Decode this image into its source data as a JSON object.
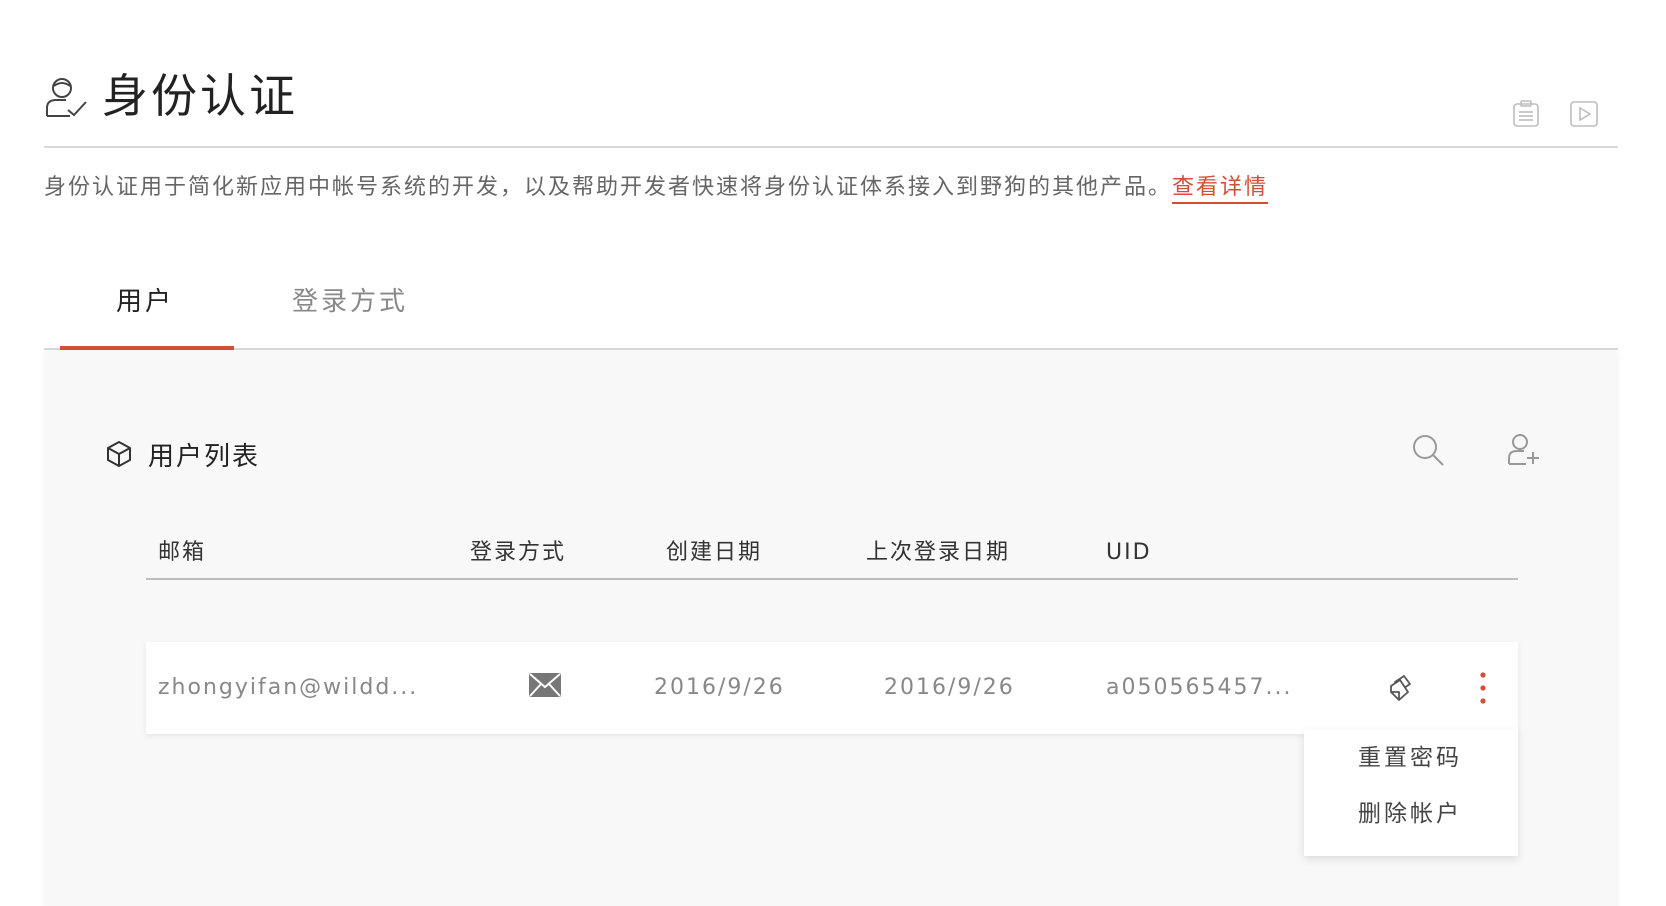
{
  "header": {
    "title": "身份认证",
    "icon": "user-check-icon",
    "tools": [
      "document-icon",
      "play-video-icon"
    ]
  },
  "description": {
    "text": "身份认证用于简化新应用中帐号系统的开发，以及帮助开发者快速将身份认证体系接入到野狗的其他产品。",
    "link": "查看详情"
  },
  "tabs": [
    {
      "label": "用户",
      "active": true
    },
    {
      "label": "登录方式",
      "active": false
    }
  ],
  "panel": {
    "title": "用户列表",
    "icon": "cube-icon",
    "actions": [
      "search-icon",
      "add-user-icon"
    ]
  },
  "table": {
    "columns": [
      "邮箱",
      "登录方式",
      "创建日期",
      "上次登录日期",
      "UID"
    ],
    "rows": [
      {
        "email": "zhongyifan@wildd...",
        "login_method": "mail-icon",
        "created": "2016/9/26",
        "last_login": "2016/9/26",
        "uid": "a050565457..."
      }
    ]
  },
  "dropdown": {
    "items": [
      "重置密码",
      "删除帐户"
    ]
  },
  "colors": {
    "accent": "#d24f35",
    "panel_bg": "#f8f8f8",
    "divider": "#d8d8d8"
  }
}
